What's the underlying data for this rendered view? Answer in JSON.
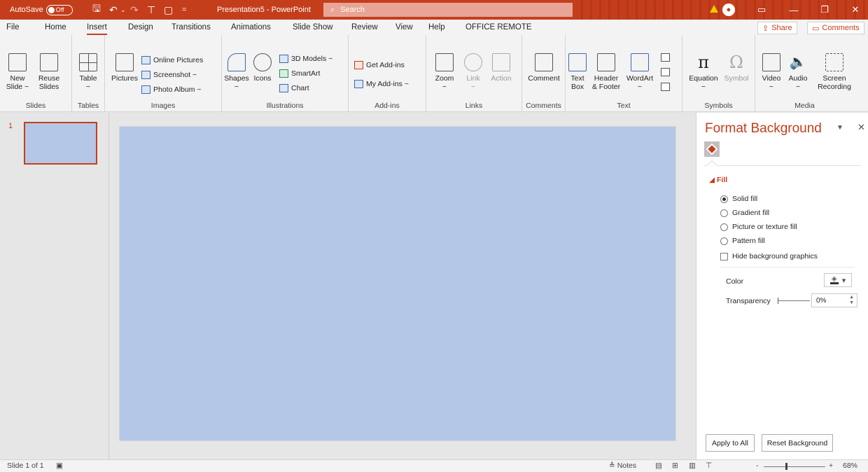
{
  "titlebar": {
    "autosave_label": "AutoSave",
    "autosave_state": "Off",
    "title": "Presentation5 - PowerPoint",
    "search_placeholder": "Search"
  },
  "tabs": [
    "File",
    "Home",
    "Insert",
    "Design",
    "Transitions",
    "Animations",
    "Slide Show",
    "Review",
    "View",
    "Help",
    "OFFICE REMOTE"
  ],
  "active_tab": "Insert",
  "share": {
    "share_label": "Share",
    "comments_label": "Comments"
  },
  "ribbon": {
    "slides": {
      "label": "Slides",
      "new_slide": "New",
      "new_slide2": "Slide ~",
      "reuse": "Reuse",
      "reuse2": "Slides"
    },
    "tables": {
      "label": "Tables",
      "table": "Table",
      "table_dd": "~"
    },
    "images": {
      "label": "Images",
      "pictures": "Pictures",
      "online_pictures": "Online Pictures",
      "screenshot": "Screenshot ~",
      "photo_album": "Photo Album ~"
    },
    "illustrations": {
      "label": "Illustrations",
      "shapes": "Shapes",
      "shapes_dd": "~",
      "icons": "Icons",
      "models": "3D Models ~",
      "smartart": "SmartArt",
      "chart": "Chart"
    },
    "addins": {
      "label": "Add-ins",
      "get": "Get Add-ins",
      "my": "My Add-ins ~"
    },
    "links": {
      "label": "Links",
      "zoom": "Zoom",
      "zoom_dd": "~",
      "link": "Link",
      "link_dd": "~",
      "action": "Action"
    },
    "comments": {
      "label": "Comments",
      "comment": "Comment"
    },
    "text": {
      "label": "Text",
      "textbox": "Text",
      "textbox2": "Box",
      "header": "Header",
      "header2": "& Footer",
      "wordart": "WordArt",
      "wordart_dd": "~"
    },
    "symbols": {
      "label": "Symbols",
      "equation": "Equation",
      "equation_dd": "~",
      "symbol": "Symbol"
    },
    "media": {
      "label": "Media",
      "video": "Video",
      "video_dd": "~",
      "audio": "Audio",
      "audio_dd": "~",
      "screen": "Screen",
      "recording": "Recording"
    }
  },
  "slides_panel": {
    "slide_number": "1"
  },
  "format_pane": {
    "title": "Format Background",
    "section": "Fill",
    "options": [
      "Solid fill",
      "Gradient fill",
      "Picture or texture fill",
      "Pattern fill"
    ],
    "selected_option": "Solid fill",
    "hide_graphics": "Hide background graphics",
    "color_label": "Color",
    "transparency_label": "Transparency",
    "transparency_value": "0%",
    "apply_all": "Apply to All",
    "reset": "Reset Background"
  },
  "status": {
    "slide_info": "Slide 1 of 1",
    "notes": "Notes",
    "zoom_minus": "-",
    "zoom_plus": "+",
    "zoom_level": "68%"
  },
  "colors": {
    "accent": "#c43e1c",
    "slide_fill": "#b4c7e7"
  }
}
